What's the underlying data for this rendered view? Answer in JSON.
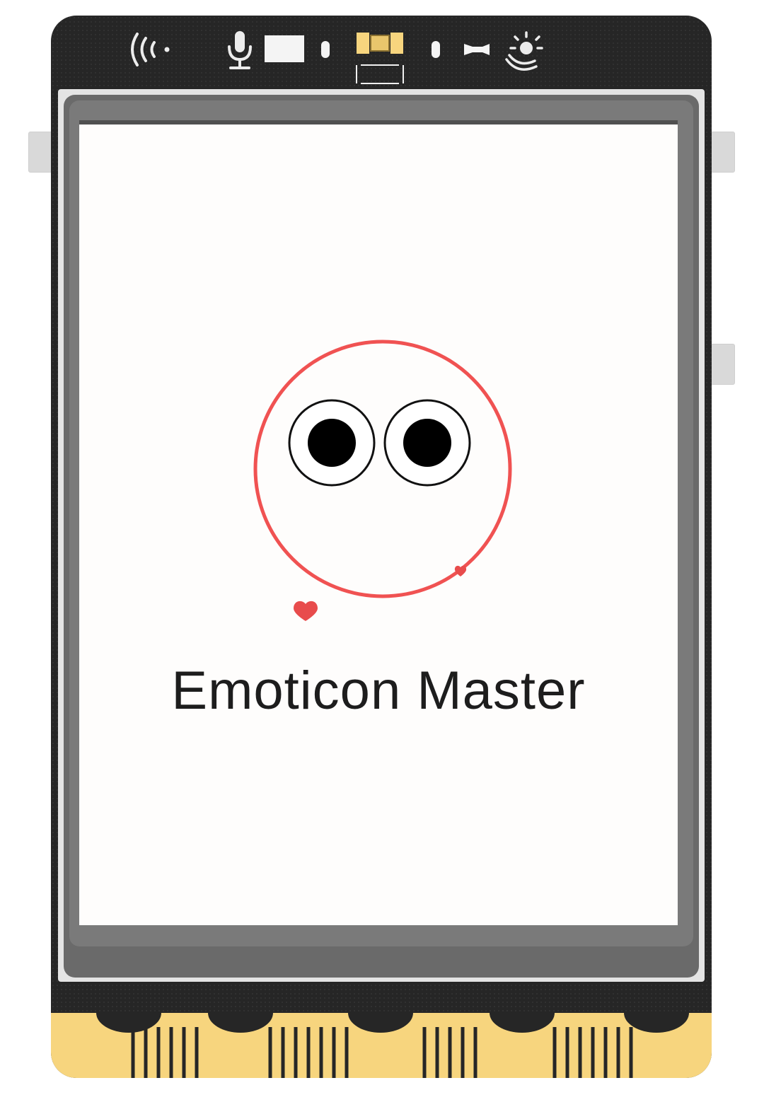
{
  "device": {
    "sensors": [
      "wireless-icon",
      "microphone-icon",
      "light-sensor-window",
      "led",
      "rgb-led-chip",
      "led",
      "buzzer",
      "sun-icon"
    ]
  },
  "screen": {
    "title": "Emoticon Master",
    "face": {
      "outline_color": "#f05252",
      "eye_color": "#000000",
      "heart_color": "#e84c4c"
    },
    "background": "#fefdfc"
  },
  "colors": {
    "board": "#262626",
    "gold_pins": "#f7d57e",
    "bezel": "#7a7a7a"
  }
}
